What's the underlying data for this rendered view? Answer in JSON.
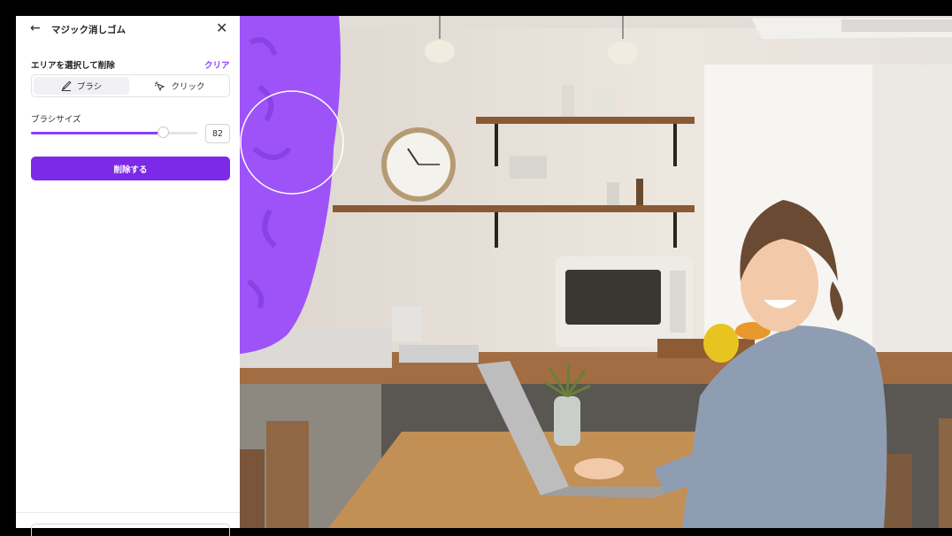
{
  "panel": {
    "title": "マジック消しゴム",
    "section_label": "エリアを選択して削除",
    "clear_label": "クリア",
    "modes": [
      {
        "label": "ブラシ",
        "icon": "brush-icon",
        "active": true
      },
      {
        "label": "クリック",
        "icon": "click-sparkle-icon",
        "active": false
      }
    ],
    "brush_size_label": "ブラシサイズ",
    "brush_size": {
      "value": "82",
      "fraction": 0.8
    },
    "erase_button_label": "削除する"
  },
  "icons": {
    "back": "back-arrow-icon",
    "close": "close-icon"
  },
  "colors": {
    "accent": "#8b3dff",
    "primary_button": "#7d2ae8",
    "brush_overlay": "#9b4dfa"
  }
}
